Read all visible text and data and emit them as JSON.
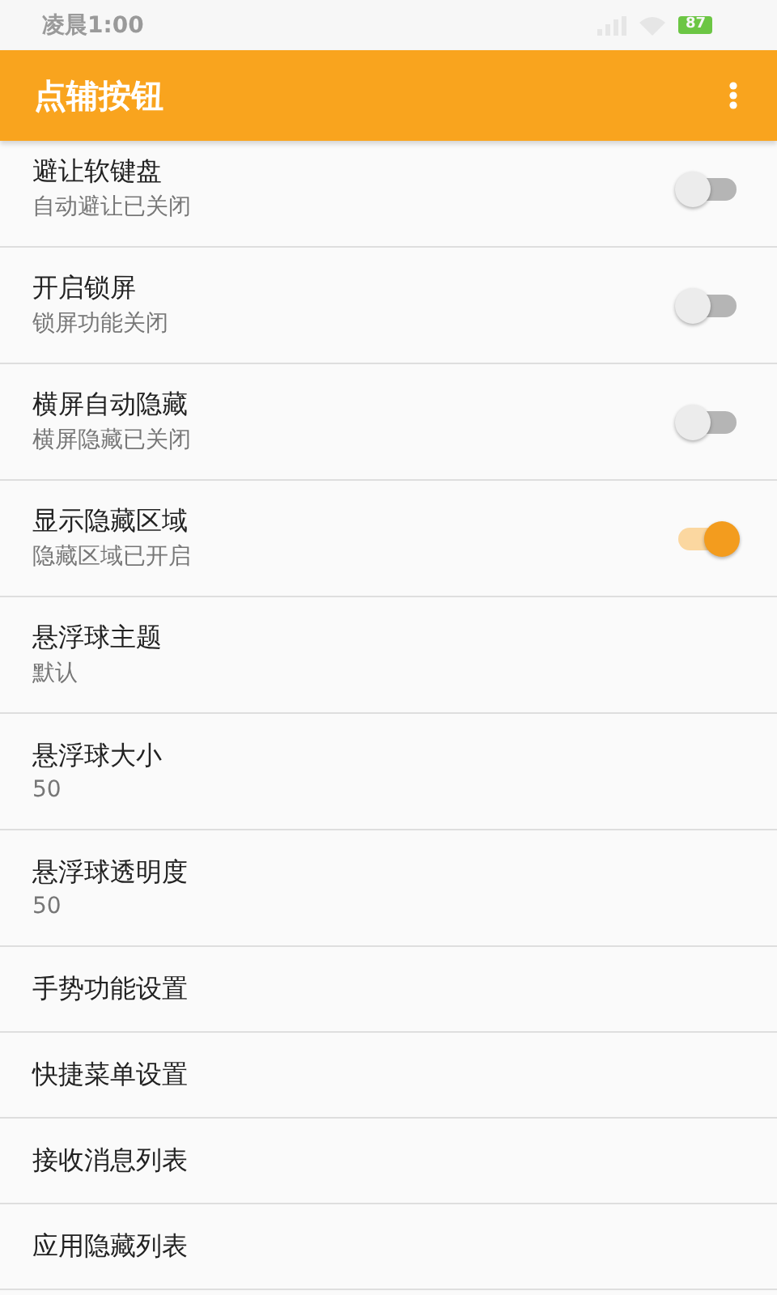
{
  "status_bar": {
    "time": "凌晨1:00",
    "battery": "87"
  },
  "app_bar": {
    "title": "点辅按钮"
  },
  "settings": [
    {
      "kind": "switch",
      "title": "避让软键盘",
      "summary": "自动避让已关闭",
      "on": false
    },
    {
      "kind": "switch",
      "title": "开启锁屏",
      "summary": "锁屏功能关闭",
      "on": false
    },
    {
      "kind": "switch",
      "title": "横屏自动隐藏",
      "summary": "横屏隐藏已关闭",
      "on": false
    },
    {
      "kind": "switch",
      "title": "显示隐藏区域",
      "summary": "隐藏区域已开启",
      "on": true
    },
    {
      "kind": "plain",
      "title": "悬浮球主题",
      "summary": "默认"
    },
    {
      "kind": "plain",
      "title": "悬浮球大小",
      "summary": "50"
    },
    {
      "kind": "plain",
      "title": "悬浮球透明度",
      "summary": "50"
    },
    {
      "kind": "plain",
      "title": "手势功能设置"
    },
    {
      "kind": "plain",
      "title": "快捷菜单设置"
    },
    {
      "kind": "plain",
      "title": "接收消息列表"
    },
    {
      "kind": "plain",
      "title": "应用隐藏列表"
    }
  ]
}
